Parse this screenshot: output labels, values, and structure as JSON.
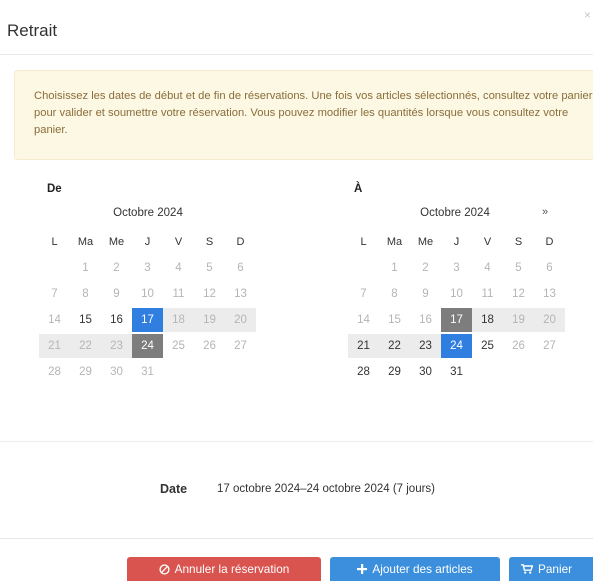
{
  "modal": {
    "title": "Retrait",
    "close": "×"
  },
  "alert": {
    "text": "Choisissez les dates de début et de fin de réservations. Une fois vos articles sélectionnés, consultez votre panier pour valider et soumettre votre réservation. Vous pouvez modifier les quantités lorsque vous consultez votre panier."
  },
  "calendars": [
    {
      "label": "De",
      "month": "Octobre 2024",
      "next": "",
      "weekdays": [
        "L",
        "Ma",
        "Me",
        "J",
        "V",
        "S",
        "D"
      ],
      "weeks": [
        [
          {
            "d": ""
          },
          {
            "d": "1",
            "s": "muted"
          },
          {
            "d": "2",
            "s": "muted"
          },
          {
            "d": "3",
            "s": "muted"
          },
          {
            "d": "4",
            "s": "muted"
          },
          {
            "d": "5",
            "s": "muted"
          },
          {
            "d": "6",
            "s": "muted"
          }
        ],
        [
          {
            "d": "7",
            "s": "muted"
          },
          {
            "d": "8",
            "s": "muted"
          },
          {
            "d": "9",
            "s": "muted"
          },
          {
            "d": "10",
            "s": "muted"
          },
          {
            "d": "11",
            "s": "muted"
          },
          {
            "d": "12",
            "s": "muted"
          },
          {
            "d": "13",
            "s": "muted"
          }
        ],
        [
          {
            "d": "14",
            "s": "muted"
          },
          {
            "d": "15",
            "s": "avail"
          },
          {
            "d": "16",
            "s": "avail"
          },
          {
            "d": "17",
            "s": "selected"
          },
          {
            "d": "18",
            "s": "muted inrange"
          },
          {
            "d": "19",
            "s": "muted inrange"
          },
          {
            "d": "20",
            "s": "muted inrange"
          }
        ],
        [
          {
            "d": "21",
            "s": "muted inrange"
          },
          {
            "d": "22",
            "s": "muted inrange"
          },
          {
            "d": "23",
            "s": "muted inrange"
          },
          {
            "d": "24",
            "s": "grey"
          },
          {
            "d": "25",
            "s": "muted"
          },
          {
            "d": "26",
            "s": "muted"
          },
          {
            "d": "27",
            "s": "muted"
          }
        ],
        [
          {
            "d": "28",
            "s": "muted"
          },
          {
            "d": "29",
            "s": "muted"
          },
          {
            "d": "30",
            "s": "muted"
          },
          {
            "d": "31",
            "s": "muted"
          },
          {
            "d": ""
          },
          {
            "d": ""
          },
          {
            "d": ""
          }
        ]
      ]
    },
    {
      "label": "À",
      "month": "Octobre 2024",
      "next": "»",
      "weekdays": [
        "L",
        "Ma",
        "Me",
        "J",
        "V",
        "S",
        "D"
      ],
      "weeks": [
        [
          {
            "d": ""
          },
          {
            "d": "1",
            "s": "muted"
          },
          {
            "d": "2",
            "s": "muted"
          },
          {
            "d": "3",
            "s": "muted"
          },
          {
            "d": "4",
            "s": "muted"
          },
          {
            "d": "5",
            "s": "muted"
          },
          {
            "d": "6",
            "s": "muted"
          }
        ],
        [
          {
            "d": "7",
            "s": "muted"
          },
          {
            "d": "8",
            "s": "muted"
          },
          {
            "d": "9",
            "s": "muted"
          },
          {
            "d": "10",
            "s": "muted"
          },
          {
            "d": "11",
            "s": "muted"
          },
          {
            "d": "12",
            "s": "muted"
          },
          {
            "d": "13",
            "s": "muted"
          }
        ],
        [
          {
            "d": "14",
            "s": "muted"
          },
          {
            "d": "15",
            "s": "muted"
          },
          {
            "d": "16",
            "s": "muted"
          },
          {
            "d": "17",
            "s": "grey"
          },
          {
            "d": "18",
            "s": "avail inrange"
          },
          {
            "d": "19",
            "s": "muted inrange"
          },
          {
            "d": "20",
            "s": "muted inrange"
          }
        ],
        [
          {
            "d": "21",
            "s": "avail inrange"
          },
          {
            "d": "22",
            "s": "avail inrange"
          },
          {
            "d": "23",
            "s": "avail inrange"
          },
          {
            "d": "24",
            "s": "selected"
          },
          {
            "d": "25",
            "s": "avail"
          },
          {
            "d": "26",
            "s": "muted"
          },
          {
            "d": "27",
            "s": "muted"
          }
        ],
        [
          {
            "d": "28",
            "s": "avail"
          },
          {
            "d": "29",
            "s": "avail"
          },
          {
            "d": "30",
            "s": "avail"
          },
          {
            "d": "31",
            "s": "avail"
          },
          {
            "d": ""
          },
          {
            "d": ""
          },
          {
            "d": ""
          }
        ]
      ]
    }
  ],
  "summary": {
    "label": "Date",
    "value": "17 octobre 2024–24 octobre 2024 (7 jours)"
  },
  "buttons": {
    "cancel": {
      "label": "Annuler la réservation",
      "icon": "ban-icon"
    },
    "add": {
      "label": "Ajouter des articles",
      "icon": "plus-icon"
    },
    "cart": {
      "label": "Panier",
      "icon": "cart-icon"
    }
  },
  "colors": {
    "selected": "#2f7ee0",
    "range": "#ececec",
    "boundary": "#7d7d7d",
    "danger": "#d9534f",
    "primary": "#3b8fdc",
    "alert_bg": "#fcf8e3"
  }
}
